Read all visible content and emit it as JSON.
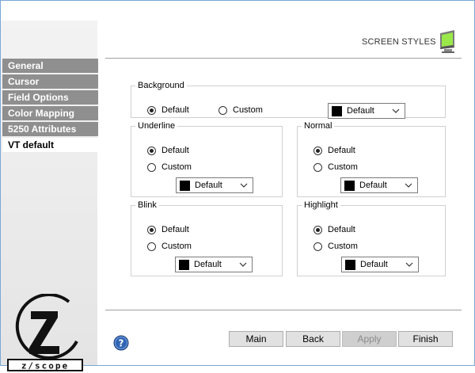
{
  "header": {
    "title": "SCREEN STYLES",
    "icon": "monitor-icon"
  },
  "sidebar": {
    "items": [
      {
        "label": "General",
        "active": false
      },
      {
        "label": "Cursor",
        "active": false
      },
      {
        "label": "Field Options",
        "active": false
      },
      {
        "label": "Color Mapping",
        "active": false
      },
      {
        "label": "5250 Attributes",
        "active": false
      },
      {
        "label": "VT default",
        "active": true
      }
    ],
    "logo_text": "z/scope"
  },
  "background": {
    "legend": "Background",
    "options": [
      {
        "label": "Default",
        "checked": true
      },
      {
        "label": "Custom",
        "checked": false
      }
    ],
    "color_select": {
      "value": "Default",
      "swatch": "#000000"
    }
  },
  "underline": {
    "legend": "Underline",
    "options": [
      {
        "label": "Default",
        "checked": true
      },
      {
        "label": "Custom",
        "checked": false
      }
    ],
    "color_select": {
      "value": "Default",
      "swatch": "#000000"
    }
  },
  "normal": {
    "legend": "Normal",
    "options": [
      {
        "label": "Default",
        "checked": true
      },
      {
        "label": "Custom",
        "checked": false
      }
    ],
    "color_select": {
      "value": "Default",
      "swatch": "#000000"
    }
  },
  "blink": {
    "legend": "Blink",
    "options": [
      {
        "label": "Default",
        "checked": true
      },
      {
        "label": "Custom",
        "checked": false
      }
    ],
    "color_select": {
      "value": "Default",
      "swatch": "#000000"
    }
  },
  "highlight": {
    "legend": "Highlight",
    "options": [
      {
        "label": "Default",
        "checked": true
      },
      {
        "label": "Custom",
        "checked": false
      }
    ],
    "color_select": {
      "value": "Default",
      "swatch": "#000000"
    }
  },
  "footer": {
    "buttons": [
      {
        "label": "Main",
        "enabled": true
      },
      {
        "label": "Back",
        "enabled": true
      },
      {
        "label": "Apply",
        "enabled": false
      },
      {
        "label": "Finish",
        "enabled": true
      }
    ],
    "help_icon": "help-icon"
  },
  "colors": {
    "accent": "#2f64b4",
    "nav_bg": "#8f8f8f",
    "border": "#7aa7d6"
  }
}
